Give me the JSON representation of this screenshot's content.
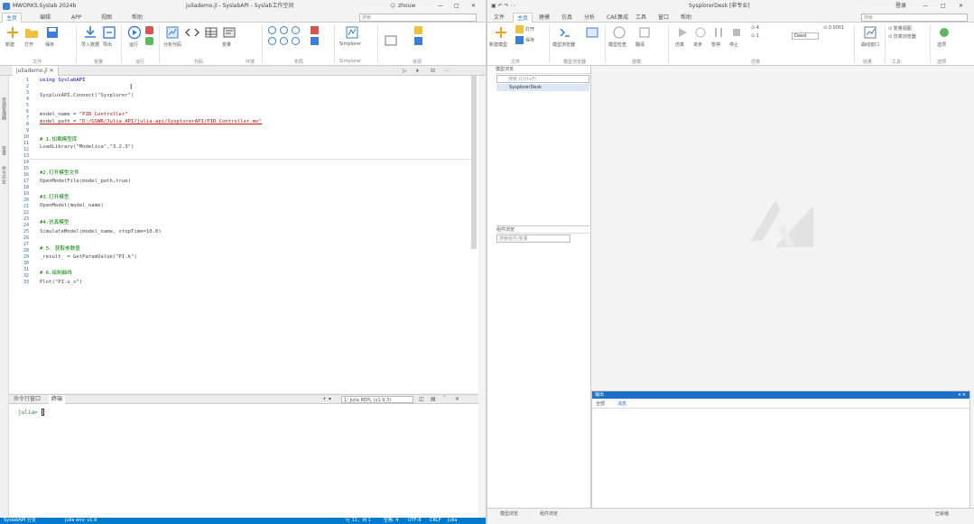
{
  "left_window": {
    "title_app": "MWORKS.Syslab 2024b",
    "title_file": "juliademo.jl - SyslabAPI - Syslab工作空间",
    "account": "zhouw",
    "menu_tabs": [
      "主页",
      "编辑",
      "APP",
      "视图",
      "帮助"
    ],
    "search_placeholder": "搜索",
    "ribbon": {
      "buttons": [
        "新建",
        "打开",
        "保存",
        "导入数据",
        "导出",
        "运行",
        "分析代码",
        "变量",
        "收藏夹",
        "布局",
        "Simplorer"
      ],
      "groups": [
        "文件",
        "变量",
        "运行",
        "代码",
        "环境",
        "布局",
        "Simplorer",
        "资源"
      ]
    },
    "doc_tab": "juliademo.jl",
    "side_labels": [
      "资源管理器",
      "变量",
      "命令历史"
    ],
    "line_numbers": [
      "1",
      "2",
      "3",
      "4",
      "5",
      "6",
      "7",
      "8",
      "9",
      "10",
      "11",
      "12",
      "13",
      "14",
      "15",
      "16",
      "17",
      "18",
      "19",
      "20",
      "21",
      "22",
      "23",
      "24",
      "25",
      "26",
      "27",
      "28",
      "29",
      "30",
      "31",
      "32",
      "33"
    ],
    "code": {
      "l1": "using SyslabAPI",
      "l2": "SysplusAPI.Connect(\"Sysplorer\")",
      "l3_a": "model_name = ",
      "l3_b": "\"PID_Controller\"",
      "l4_a": "model_path = ",
      "l4_b": "\"D:/GSWR/Julia API/julia-api/SysplorerAPI/PID_Controller.mo\"",
      "l5": "# 1.加载模型库",
      "l6": "LoadLibrary(\"Modelica\",\"3.2.3\")",
      "l7": "#2.打开模型文件",
      "l8": "OpenModelFile(model_path,true)",
      "l9": "#3.打开模型",
      "l10": "OpenModel(model_name)",
      "l11": "#4.仿真模型",
      "l12": "SimulateModel(model_name, stopTime=10.0)",
      "l13": "# 5. 获取参数值",
      "l14": "_result_ = GetParamValue(\"PI.k\")",
      "l15": "# 6.绘制曲线",
      "l16": "Plot(\"PI.u_s\")"
    },
    "terminal_tabs": [
      "命令行窗口",
      "终端"
    ],
    "terminal_selector": "1: Julia REPL (v1.9.3)",
    "terminal_prompt": "julia>",
    "status_left": "SyslabAPI 分支",
    "status_item2": "Julia env: v1.9",
    "status_right": [
      "行 11，列 1",
      "空格: 4",
      "UTF-8",
      "CRLF",
      "Julia"
    ]
  },
  "right_window": {
    "title": "SysplorerDesk [非专业]",
    "account": "登录",
    "search_placeholder": "搜索",
    "menu_tabs": [
      "文件",
      "主页",
      "建模",
      "仿真",
      "分析",
      "CAE集成",
      "工具",
      "窗口",
      "帮助"
    ],
    "ribbon": {
      "buttons": [
        "新建模型",
        "打开",
        "保存",
        "模型浏览器",
        "建模",
        "模型检查",
        "翻译",
        "仿真",
        "单步",
        "暂停",
        "停止",
        "曲线窗口",
        "变量视图",
        "仿真浏览器",
        "选项"
      ],
      "groups": [
        "文件",
        "模型浏览器",
        "建模",
        "仿真",
        "结果",
        "工具",
        "选项"
      ],
      "sim_stop": "4",
      "sim_step": "1",
      "sim_algo": "Dassl",
      "sim_tol": "0.0001"
    },
    "nav_title": "模型浏览",
    "nav_search_placeholder": "搜索 (Ctrl+F)",
    "tree_item": "SysplorerDesk",
    "comp_title": "组件浏览",
    "comp_search_placeholder": "搜索组件/变量",
    "output_title": "输出",
    "output_tabs": [
      "全部",
      "消息"
    ],
    "status_tabs": [
      "模型浏览",
      "组件浏览"
    ],
    "status_right": "已就绪",
    "accent_color": "#1e6fc8"
  }
}
